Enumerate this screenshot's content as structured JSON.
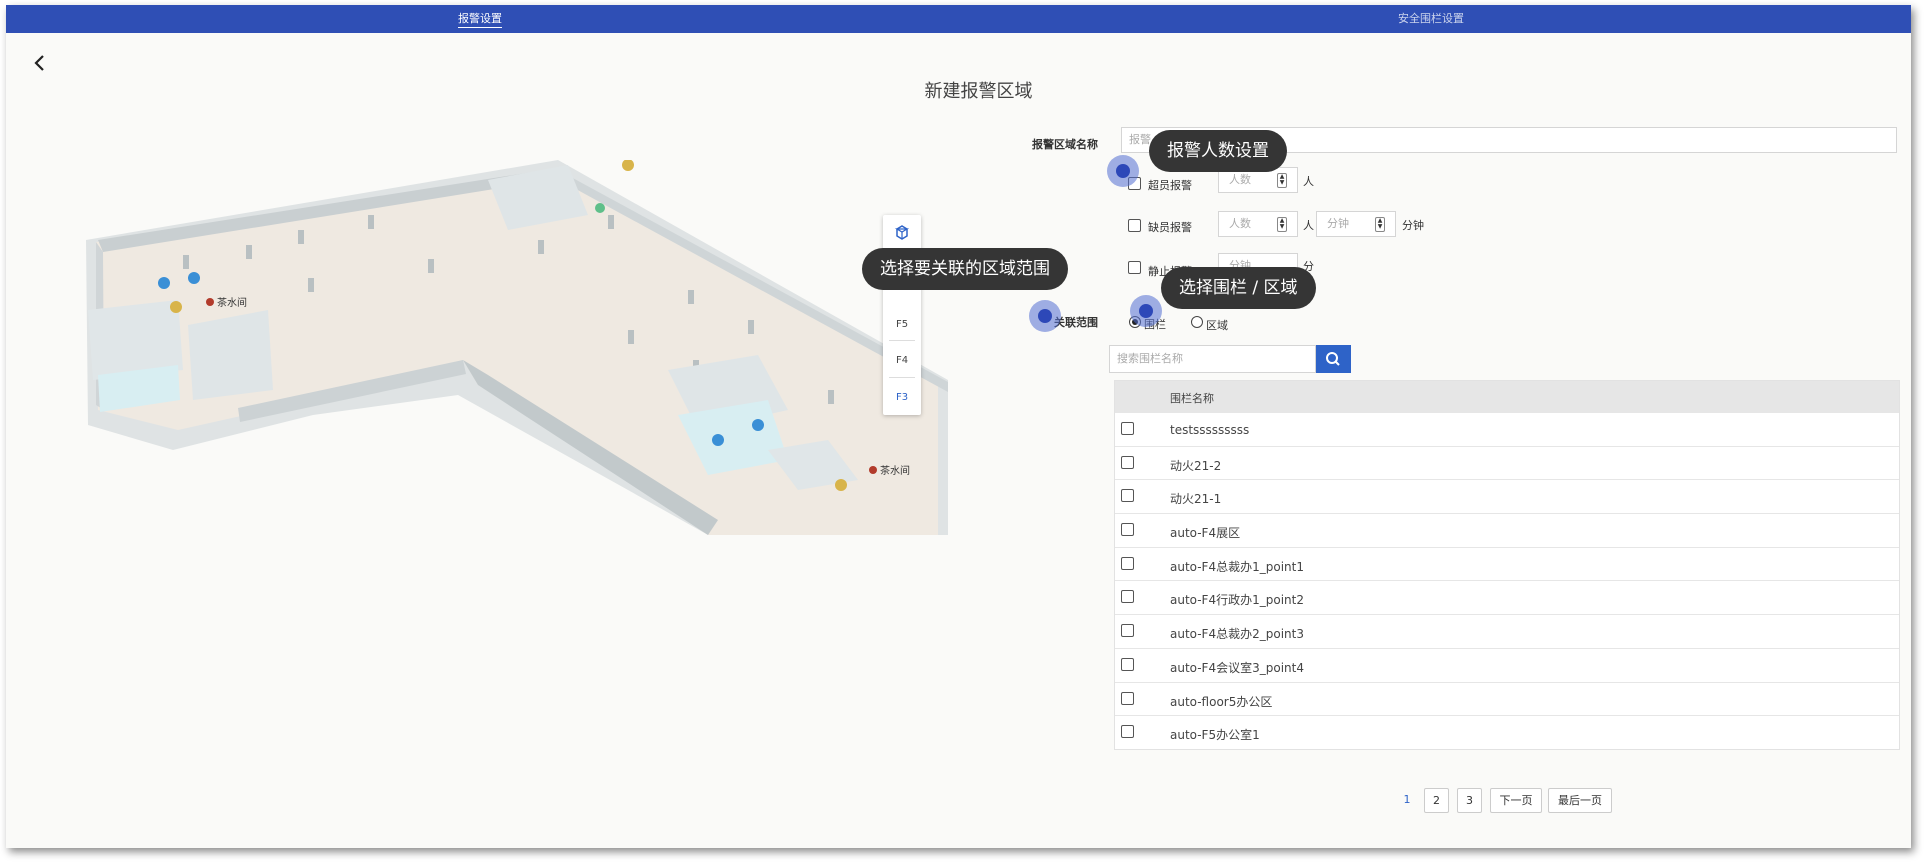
{
  "tabs": {
    "alarm_settings": "报警设置",
    "safety_helmet": "安全围栏设置"
  },
  "page": {
    "title": "新建报警区域"
  },
  "map": {
    "poi_tea_room": "茶水间",
    "floor_control": {
      "mode_3d": "3D",
      "floors": [
        "F5",
        "F4",
        "F3"
      ],
      "active_floor": "F3"
    }
  },
  "form": {
    "area_name_label": "报警区域名称",
    "area_name_placeholder": "报警",
    "over_alarm_label": "超员报警",
    "short_alarm_label": "缺员报警",
    "still_alarm_label": "静止报警",
    "people_placeholder": "人数",
    "minute_placeholder": "分钟",
    "unit_person": "人",
    "unit_minute": "分钟",
    "unit_minute_short": "分",
    "associate_label": "关联范围",
    "radio_fence": "围栏",
    "radio_region": "区域",
    "search_placeholder": "搜索围栏名称"
  },
  "table": {
    "header": "围栏名称",
    "rows": [
      "testsssssssss",
      "动火21-2",
      "动火21-1",
      "auto-F4展区",
      "auto-F4总裁办1_point1",
      "auto-F4行政办1_point2",
      "auto-F4总裁办2_point3",
      "auto-F4会议室3_point4",
      "auto-floor5办公区",
      "auto-F5办公室1"
    ]
  },
  "pagination": {
    "pages": [
      "1",
      "2",
      "3"
    ],
    "current": "1",
    "next": "下一页",
    "last": "最后一页"
  },
  "tooltips": {
    "people_settings": "报警人数设置",
    "select_range": "选择要关联的区域范围",
    "select_fence_region": "选择围栏 / 区域"
  },
  "colors": {
    "topbar": "#2f4fb5",
    "accent": "#2e63c8",
    "tooltip_bg": "#353535"
  }
}
